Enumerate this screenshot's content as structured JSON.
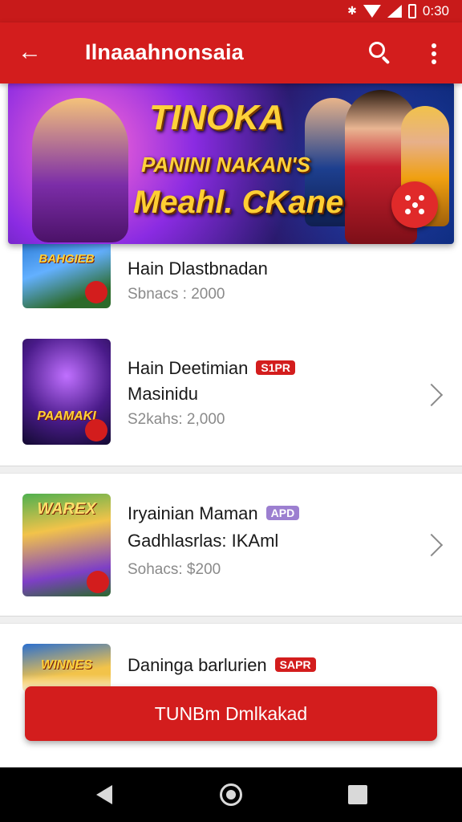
{
  "status_bar": {
    "time": "0:30",
    "bluetooth_icon": "bluetooth-icon",
    "wifi_icon": "wifi-icon",
    "signal_icon": "signal-icon",
    "battery_icon": "battery-icon"
  },
  "app_bar": {
    "title": "Ilnaaahnonsaia",
    "back_icon": "arrow-left-icon",
    "search_icon": "search-icon",
    "more_icon": "more-vert-icon",
    "color": "#d31d1d"
  },
  "banner": {
    "line1": "TINOKA",
    "line2": "PANINI NAKAN'S",
    "line3": "Meahl. CKane",
    "fab_icon": "dice-icon"
  },
  "items": [
    {
      "name": "Hain Dlastbnadan",
      "subtitle": "",
      "tag": "",
      "meta": "Sbnacs : 2000",
      "thumb_label": "BAHGIEB",
      "has_chevron": false
    },
    {
      "name": "Hain Deetimian",
      "subtitle": "Masinidu",
      "tag": "S1PR",
      "tag_color": "#d31d1d",
      "meta": "S2kahs: 2,000",
      "thumb_label": "PAAMAKI",
      "has_chevron": true
    },
    {
      "name": "Iryainian Maman",
      "subtitle": "Gadhlasrlas: IKAml",
      "tag": "APD",
      "tag_color": "#9c7fd0",
      "meta": "Sohacs: $200",
      "thumb_label": "WAREX",
      "has_chevron": true
    },
    {
      "name": "Daninga barlurien",
      "subtitle": "",
      "tag": "SAPR",
      "tag_color": "#d31d1d",
      "meta": "",
      "thumb_label": "WINNES",
      "has_chevron": false
    }
  ],
  "cta": {
    "label": "TUNBm Dmlkakad"
  },
  "nav_bar": {
    "back_icon": "nav-back-icon",
    "home_icon": "nav-home-icon",
    "recents_icon": "nav-recents-icon"
  }
}
